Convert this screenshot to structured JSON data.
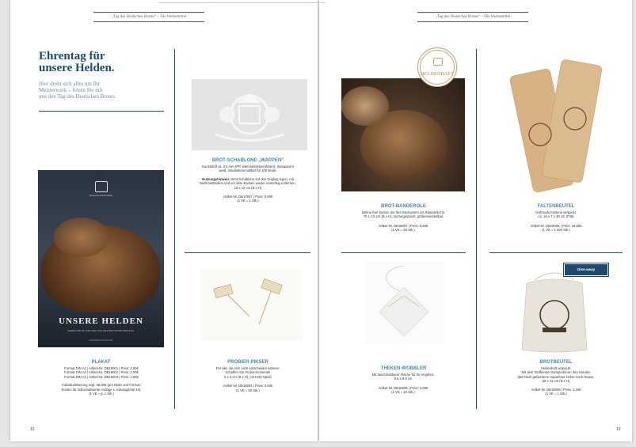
{
  "header": {
    "running_left": "„Tag des Deutschen Brotes“ – Die Werbemittel",
    "running_right": "„Tag des Deutschen Brotes“ – Die Werbemittel"
  },
  "intro": {
    "headline_1": "Ehrentag für",
    "headline_2": "unsere Helden.",
    "sub_1": "Hier dreht sich alles um Ihr",
    "sub_2": "Meisterwerk – feiern Sie mit",
    "sub_3": "uns den Tag des Deutschen Brotes."
  },
  "poster": {
    "brand": "Deutsches Brotinstitut",
    "title": "UNSERE HELDEN",
    "tagline": "FEIERN SIE MIT UNS DEN TAG DES DEUTSCHEN BROTES.",
    "fineprint": "WWW.BROTINSTITUT.DE"
  },
  "badge": {
    "label": "HELDENHAFT"
  },
  "giveaway": {
    "label": "Give-away"
  },
  "products": {
    "plakat": {
      "title": "PLAKAT",
      "l1": "Format DIN A1 | Artikel-Nr. DB18001 | Preis: 2,50€",
      "l2": "Format DIN A3 | Artikel-Nr. DB18002 | Preis: 2,00€",
      "l3": "Format DIN A4 | Artikel-Nr. DB18003 | Preis: 1,50€",
      "l4": "Individualisierung zzgl. 35,00€ (pro Motiv und Format;",
      "l5": "Kosten für individualisierte Auflage s. Katalogseite 44).",
      "l6": "(1 VE = je 1 Stk.)"
    },
    "schablone": {
      "title": "BROT-SCHABLONE „WAPPEN“",
      "l1": "Kunststoff ca. 0,5 mm (PP, lebensmittelzertifiziert), transparent",
      "l2": "weiß, mindestens haltbar für 100 Brote.",
      "hint_label": "Nutzungshinweis:",
      "l3": "Brot-Schablone auf den Teigling legen, mit",
      "l4": "Mehl bestäuben und vor dem Backen wieder vorsichtig entfernen.",
      "l5": "18 x 12 cm (B x H)",
      "l6": "Artikel-Nr. DB17507 | Preis: 8,90€",
      "l7": "(1 VE = 1 Stk.)"
    },
    "piekser": {
      "title": "PROBIER-PIKSER",
      "l1": "Für alle, die sich nicht entscheiden können:",
      "l2": "Schaffen Sie Probiermomente!",
      "l3": "5 x 3 cm (B x H), mit Holz-Spieß",
      "l4": "Artikel-Nr. DB18004 | Preis: 3,80€",
      "l5": "(1 VE = 50 Stk.)"
    },
    "banderole": {
      "title": "BROT-BANDEROLE",
      "l1": "Bühne frei! Setzen Sie Ihre Backwaren ins Rampenlicht!",
      "l2": "70 x 4,5 cm (B x H), konturgestanzt, größenverstellbar",
      "l3": "Artikel-Nr. DB18007 | Preis: 5,60€",
      "l4": "(1 VE = 50 Stk.)"
    },
    "wobbler": {
      "title": "THEKEN-WOBBLER",
      "l1": "Mit beschreibbarer Fläche für Ihr Angebot.",
      "l2": "9,8 x 9,8 cm",
      "l3": "Artikel-Nr. DB18005 | Preis: 2,00€",
      "l4": "(1 VE = 10 Stk.)"
    },
    "faltenbeutel": {
      "title": "FALTENBEUTEL",
      "l1": "Vorfreude bestens verpackt.",
      "l2": "ca. 16 x 7 x 36 cm (F36)",
      "l3": "Artikel-Nr. DB18006 | Preis: 19,90€",
      "l4": "(1 VE = 1.000 Stk.)"
    },
    "brotbeutel": {
      "title": "BROTBEUTEL",
      "l1": "Heldenhaft verpackt.",
      "l2": "Mit dem Stoffbeutel transportieren Ihre Kunden",
      "l3": "das frisch gebackene Superfood sicher nach Hause.",
      "l4": "38 x 42 cm (B x H)",
      "l5": "Artikel-Nr. DB18008 | Preis: 1,20€",
      "l6": "(1 VE = 1 Stk.)"
    }
  },
  "page_numbers": {
    "left": "12",
    "right": "13"
  }
}
